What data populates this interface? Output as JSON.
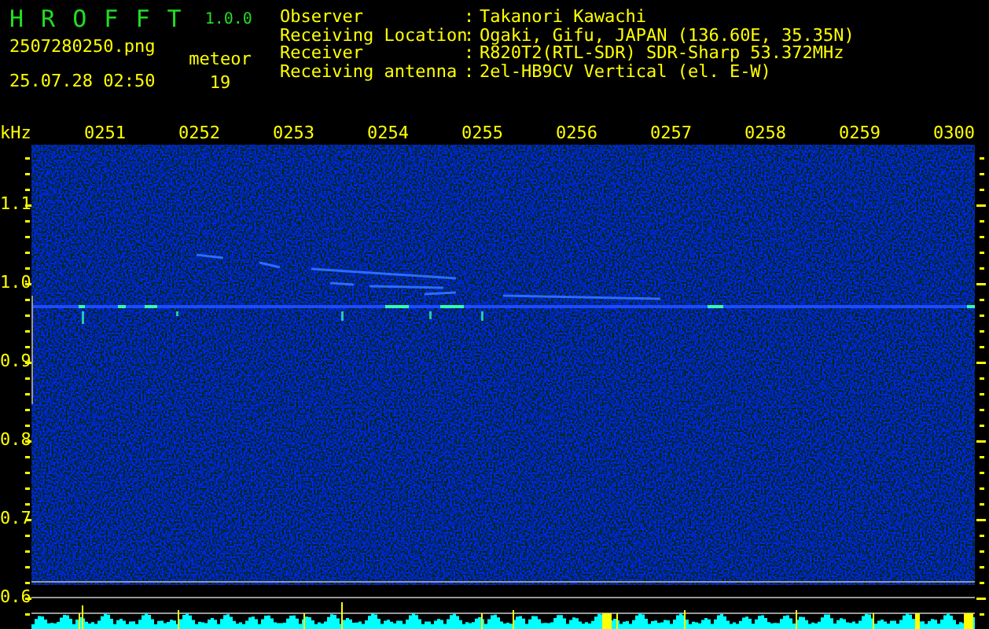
{
  "app": {
    "title": "H R O F F T",
    "version": "1.0.0",
    "filename": "2507280250.png",
    "timestamp": "25.07.28 02:50",
    "meteor_label": "meteor",
    "meteor_count": "19"
  },
  "station": [
    {
      "label": "Observer",
      "separator": ":",
      "value": "Takanori Kawachi"
    },
    {
      "label": "Receiving Location",
      "separator": ":",
      "value": "Ogaki, Gifu, JAPAN (136.60E, 35.35N)"
    },
    {
      "label": "Receiver",
      "separator": ":",
      "value": "R820T2(RTL-SDR) SDR-Sharp 53.372MHz"
    },
    {
      "label": "Receiving antenna",
      "separator": ":",
      "value": "2el-HB9CV Vertical (el. E-W)"
    }
  ],
  "spectrogram": {
    "y_unit": "kHz",
    "x_labels": [
      "0251",
      "0252",
      "0253",
      "0254",
      "0255",
      "0256",
      "0257",
      "0258",
      "0259",
      "0300"
    ],
    "y_labels": [
      "1.1",
      "1.0",
      "0.9",
      "0.8",
      "0.7",
      "0.6"
    ]
  }
}
